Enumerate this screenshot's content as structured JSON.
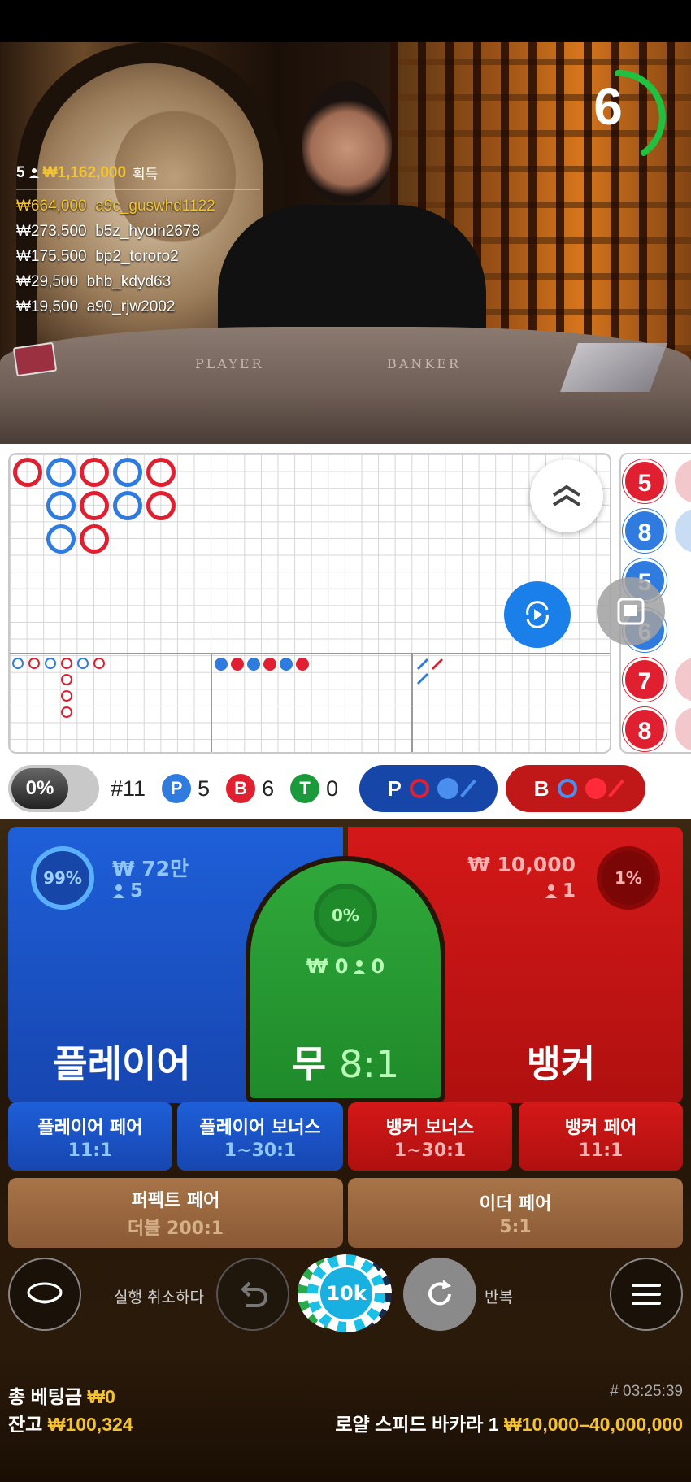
{
  "timer": {
    "seconds": "6"
  },
  "winners": {
    "count": "5",
    "total": "₩1,162,000",
    "suffix": "획득",
    "list": [
      {
        "amount": "₩664,000",
        "user": "a9c_guswhd1122"
      },
      {
        "amount": "₩273,500",
        "user": "b5z_hyoin2678"
      },
      {
        "amount": "₩175,500",
        "user": "bp2_tororo2"
      },
      {
        "amount": "₩29,500",
        "user": "bhb_kdyd63"
      },
      {
        "amount": "₩19,500",
        "user": "a90_rjw2002"
      }
    ]
  },
  "table_labels": {
    "player": "PLAYER",
    "banker": "BANKER"
  },
  "side_road": [
    "5",
    "8",
    "5",
    "6",
    "7",
    "8"
  ],
  "stats": {
    "percent": "0%",
    "round": "#11",
    "player_letter": "P",
    "player_count": "5",
    "banker_letter": "B",
    "banker_count": "6",
    "tie_letter": "T",
    "tie_count": "0",
    "predict_player": "P",
    "predict_banker": "B"
  },
  "bets": {
    "player": {
      "pct": "99%",
      "amount": "₩ 72만",
      "players": "5",
      "title": "플레이어"
    },
    "tie": {
      "pct": "0%",
      "amount": "₩ 0",
      "players": "0",
      "title": "무",
      "odds": "8:1"
    },
    "banker": {
      "pct": "1%",
      "amount": "₩ 10,000",
      "players": "1",
      "title": "뱅커"
    },
    "side": [
      {
        "label": "플레이어 페어",
        "odds": "11:1"
      },
      {
        "label": "플레이어 보너스",
        "odds": "1~30:1"
      },
      {
        "label": "뱅커 보너스",
        "odds": "1~30:1"
      },
      {
        "label": "뱅커 페어",
        "odds": "11:1"
      }
    ],
    "perfect": {
      "label": "퍼펙트 페어",
      "odds": "더블 200:1"
    },
    "either": {
      "label": "이더 페어",
      "odds": "5:1"
    }
  },
  "controls": {
    "undo_label": "실행 취소하다",
    "chip": "10k",
    "repeat_label": "반복"
  },
  "footer": {
    "total_bet_label": "총 베팅금",
    "total_bet": "₩0",
    "balance_label": "잔고",
    "balance": "₩100,324",
    "game_id": "# 03:25:39",
    "table_name": "로얄 스피드 바카라 1",
    "limits": "₩10,000–40,000,000"
  },
  "colors": {
    "player": "#1e5fd8",
    "banker": "#d41818",
    "tie": "#2fa83a",
    "gold": "#f4c430"
  }
}
